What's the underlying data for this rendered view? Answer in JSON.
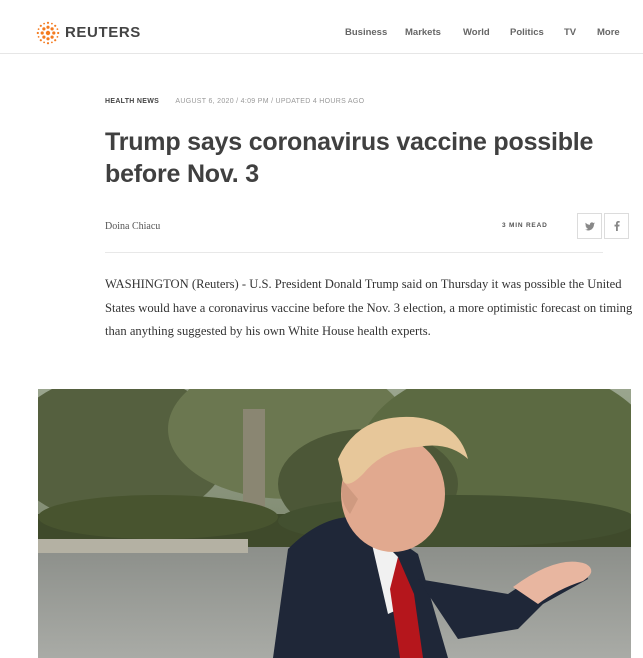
{
  "header": {
    "brand": "REUTERS",
    "nav": [
      "Business",
      "Markets",
      "World",
      "Politics",
      "TV",
      "More"
    ]
  },
  "article": {
    "section": "HEALTH NEWS",
    "dateline": "AUGUST 6, 2020 / 4:09 PM / UPDATED 4 HOURS AGO",
    "headline": "Trump says coronavirus vaccine possible before Nov. 3",
    "author": "Doina Chiacu",
    "read_time": "3 MIN READ",
    "lede": "WASHINGTON (Reuters) - U.S. President Donald Trump said on Thursday it was possible the United States would have a coronavirus vaccine before the Nov. 3 election, a more optimistic forecast on timing than anything suggested by his own White House health experts."
  },
  "icons": {
    "logo": "reuters-logo-icon",
    "share": [
      "twitter-icon",
      "facebook-icon"
    ]
  },
  "colors": {
    "brand_orange": "#f47b20",
    "text": "#404040",
    "muted": "#999999"
  }
}
